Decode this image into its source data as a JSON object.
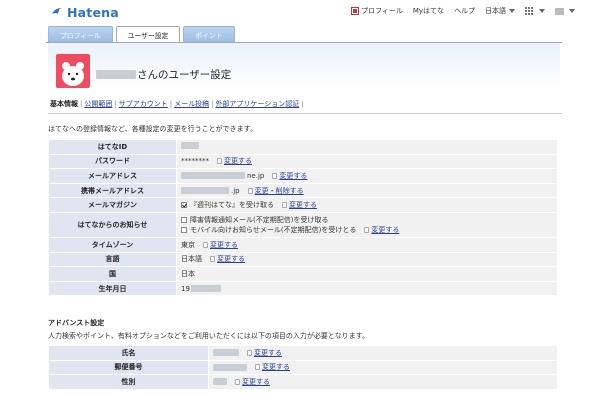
{
  "app": {
    "logo_text": "Hatena"
  },
  "topbar": {
    "profile_label": "プロフィール",
    "myhatena_label": "Myはてな",
    "help_label": "ヘルプ",
    "language_label": "日本語"
  },
  "tabs": [
    {
      "label": "プロフィール",
      "active": false
    },
    {
      "label": "ユーザー設定",
      "active": true
    },
    {
      "label": "ポイント",
      "active": false
    }
  ],
  "header": {
    "title_suffix": "さんのユーザー設定",
    "avatar_color": "#f14b5f"
  },
  "subnav": [
    {
      "label": "基本情報",
      "current": true
    },
    {
      "label": "公開範囲",
      "current": false
    },
    {
      "label": "サブアカウント",
      "current": false
    },
    {
      "label": "メール投稿",
      "current": false
    },
    {
      "label": "外部アプリケーション認証",
      "current": false
    }
  ],
  "intro_text": "はてなへの登録情報など、各種設定の変更を行うことができます。",
  "basic": {
    "id_label": "はてなID",
    "password_label": "パスワード",
    "password_value": "********",
    "password_link": "変更する",
    "mail_label": "メールアドレス",
    "mail_value_suffix": "ne.jp",
    "mail_link": "変更する",
    "mobile_label": "携帯メールアドレス",
    "mobile_value_suffix": ".jp",
    "mobile_link": "変更・削除する",
    "magazine_label": "メールマガジン",
    "magazine_option": "『週刊はてな』を受け取る",
    "magazine_link": "変更する",
    "notice_label": "はてなからのお知らせ",
    "notice_option1": "障害情報通知メール(不定期配信)を受け取る",
    "notice_option2": "モバイル向けお知らせメール(不定期配信)を受けとる",
    "notice_link": "変更する",
    "timezone_label": "タイムゾーン",
    "timezone_value": "東京",
    "timezone_link": "変更する",
    "lang_label": "言語",
    "lang_value": "日本語",
    "lang_link": "変更する",
    "country_label": "国",
    "country_value": "日本",
    "birthday_label": "生年月日",
    "birthday_value_prefix": "19"
  },
  "advanced": {
    "title": "アドバンスト設定",
    "desc": "人力検索やポイント、有料オプションなどをご利用いただくには以下の項目の入力が必要となります。",
    "name_label": "氏名",
    "name_link": "変更する",
    "zip_label": "郵便番号",
    "zip_link": "変更する",
    "gender_label": "性別",
    "gender_link": "変更する"
  },
  "colors": {
    "link": "#2a3f9a",
    "label_bg": "#dfe6f2",
    "value_bg": "#f1f1f1",
    "brand": "#2d73c6"
  }
}
